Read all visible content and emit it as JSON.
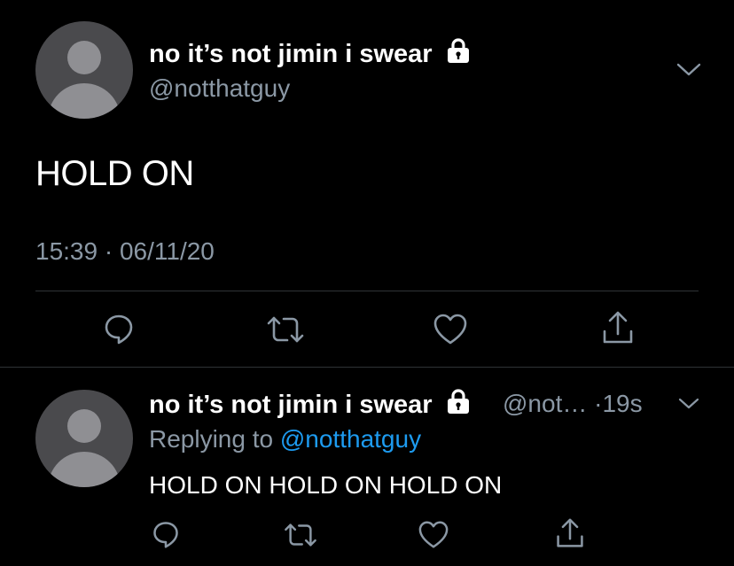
{
  "tweet": {
    "display_name": "no it’s not jimin i swear",
    "handle": "@notthatguy",
    "text": "HOLD ON",
    "time": "15:39",
    "separator": "·",
    "date": "06/11/20",
    "icons": {
      "lock": "lock-icon",
      "menu": "chevron-down-icon",
      "reply": "reply-icon",
      "retweet": "retweet-icon",
      "like": "heart-icon",
      "share": "share-icon"
    }
  },
  "reply_tweet": {
    "display_name": "no it’s not jimin i swear",
    "handle_truncated": "@not…",
    "age": "·19s",
    "replying_prefix": "Replying to",
    "replying_to": "@notthatguy",
    "text": "HOLD ON HOLD ON HOLD ON"
  },
  "colors": {
    "background": "#000000",
    "secondary_text": "#8b98a5",
    "link": "#1d9bf0",
    "divider": "#2f3336",
    "avatar_bg": "#4a4a4d",
    "avatar_fg": "#8f8f93"
  }
}
